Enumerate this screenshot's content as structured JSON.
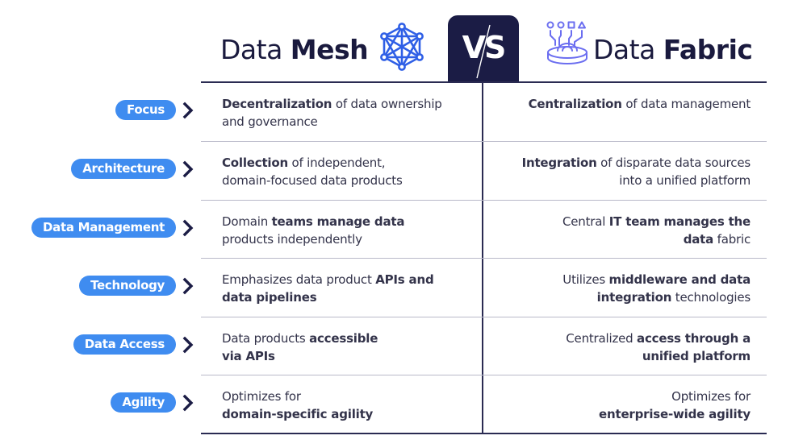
{
  "header": {
    "left_title_light": "Data",
    "left_title_bold": "Mesh",
    "left_icon": "network-mesh-icon",
    "vs_label": "VS",
    "right_title_light": "Data",
    "right_title_bold": "Fabric",
    "right_icon": "data-fabric-integration-icon"
  },
  "colors": {
    "navy": "#1b1c45",
    "pill_blue": "#3f8cf0",
    "mesh_icon_blue": "#2f5fe6",
    "fabric_icon_purple": "#6b6ef0",
    "divider_gray": "#b9b9c9"
  },
  "rows": [
    {
      "category": "Focus",
      "mesh": [
        {
          "t": "Decentralization",
          "b": true
        },
        {
          "t": " of data ownership",
          "b": false
        },
        {
          "br": true
        },
        {
          "t": "and governance",
          "b": false
        }
      ],
      "fabric": [
        {
          "t": "Centralization",
          "b": true
        },
        {
          "t": " of data management",
          "b": false
        }
      ]
    },
    {
      "category": "Architecture",
      "mesh": [
        {
          "t": "Collection",
          "b": true
        },
        {
          "t": " of independent,",
          "b": false
        },
        {
          "br": true
        },
        {
          "t": "domain-focused data products",
          "b": false
        }
      ],
      "fabric": [
        {
          "t": "Integration",
          "b": true
        },
        {
          "t": " of disparate data sources",
          "b": false
        },
        {
          "br": true
        },
        {
          "t": "into a unified platform",
          "b": false
        }
      ]
    },
    {
      "category": "Data Management",
      "mesh": [
        {
          "t": "Domain ",
          "b": false
        },
        {
          "t": "teams manage data",
          "b": true
        },
        {
          "br": true
        },
        {
          "t": "products independently",
          "b": false
        }
      ],
      "fabric": [
        {
          "t": "Central ",
          "b": false
        },
        {
          "t": "IT team manages the",
          "b": true
        },
        {
          "br": true
        },
        {
          "t": "data",
          "b": true
        },
        {
          "t": " fabric",
          "b": false
        }
      ]
    },
    {
      "category": "Technology",
      "mesh": [
        {
          "t": "Emphasizes data product ",
          "b": false
        },
        {
          "t": "APIs and",
          "b": true
        },
        {
          "br": true
        },
        {
          "t": "data pipelines",
          "b": true
        }
      ],
      "fabric": [
        {
          "t": "Utilizes ",
          "b": false
        },
        {
          "t": "middleware and data",
          "b": true
        },
        {
          "br": true
        },
        {
          "t": "integration",
          "b": true
        },
        {
          "t": " technologies",
          "b": false
        }
      ]
    },
    {
      "category": "Data Access",
      "mesh": [
        {
          "t": "Data products ",
          "b": false
        },
        {
          "t": "accessible",
          "b": true
        },
        {
          "br": true
        },
        {
          "t": "via APIs",
          "b": true
        }
      ],
      "fabric": [
        {
          "t": "Centralized ",
          "b": false
        },
        {
          "t": "access through a",
          "b": true
        },
        {
          "br": true
        },
        {
          "t": "unified platform",
          "b": true
        }
      ]
    },
    {
      "category": "Agility",
      "mesh": [
        {
          "t": "Optimizes for",
          "b": false
        },
        {
          "br": true
        },
        {
          "t": "domain-specific agility",
          "b": true
        }
      ],
      "fabric": [
        {
          "t": "Optimizes for",
          "b": false
        },
        {
          "br": true
        },
        {
          "t": "enterprise-wide agility",
          "b": true
        }
      ]
    }
  ]
}
